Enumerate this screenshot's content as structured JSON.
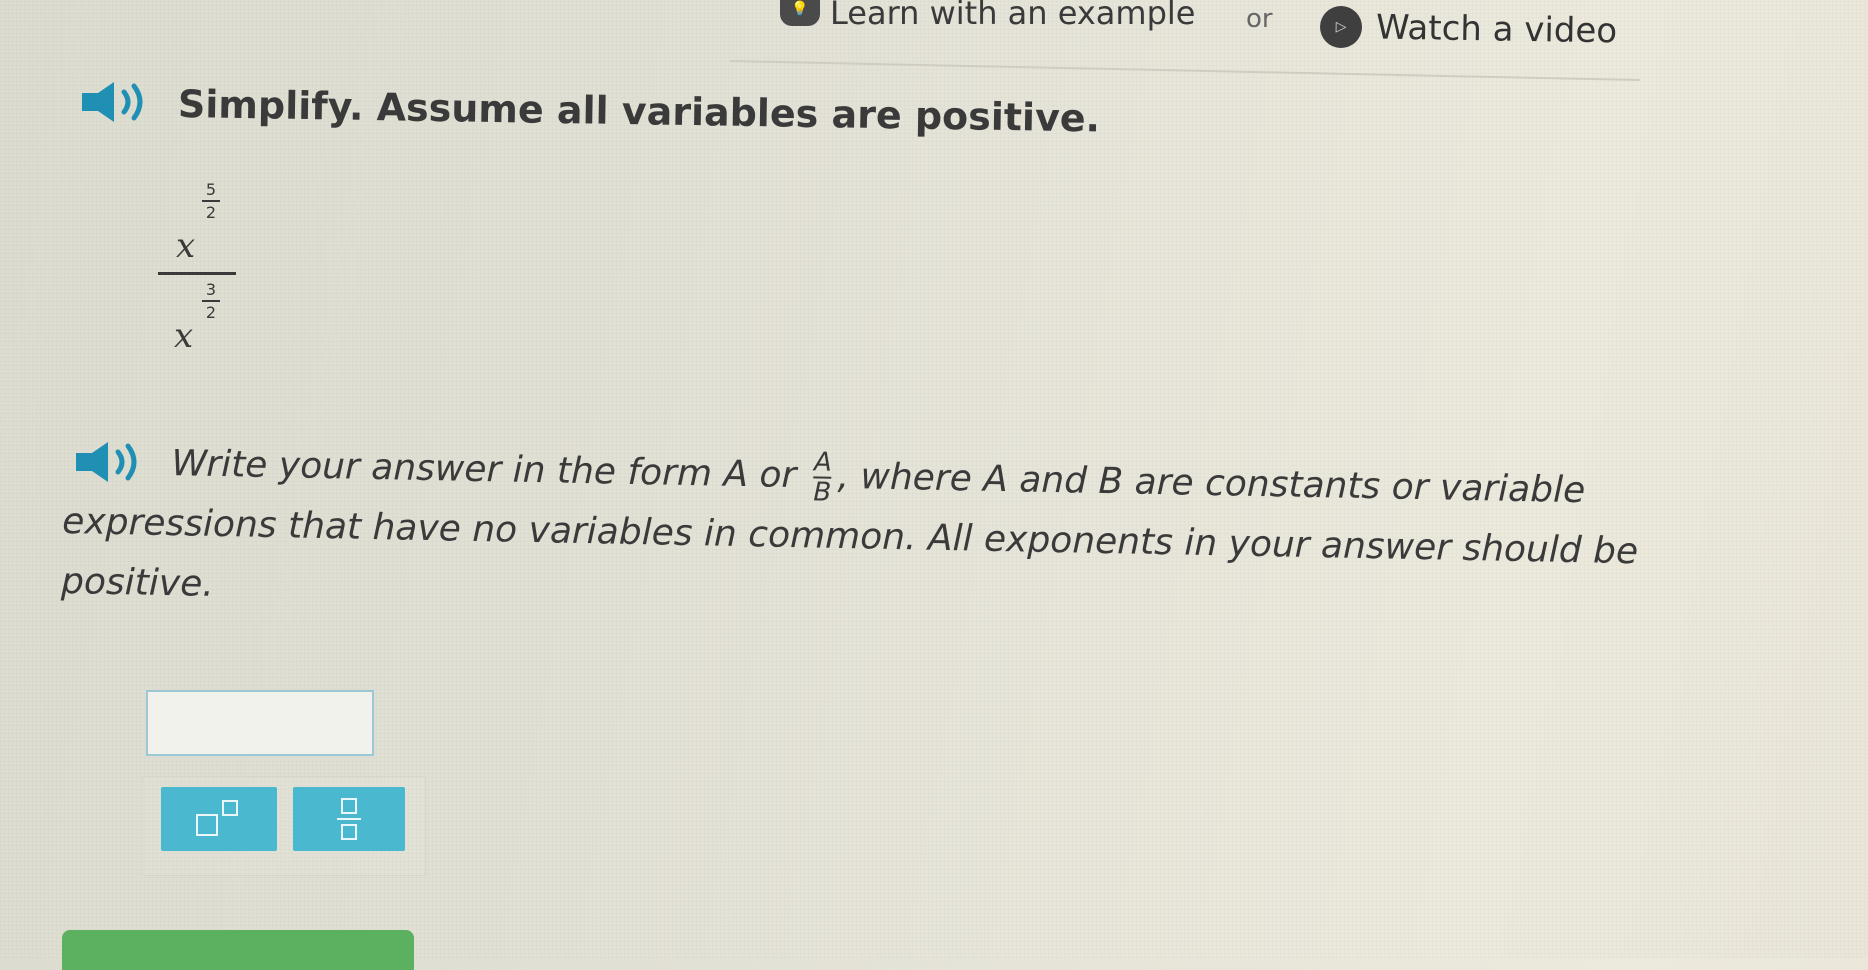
{
  "help": {
    "learn_label": "Learn with an example",
    "or_label": "or",
    "video_label": "Watch a video"
  },
  "question": {
    "prompt": "Simplify. Assume all variables are positive.",
    "expression": {
      "numerator_base": "x",
      "numerator_exp_num": "5",
      "numerator_exp_den": "2",
      "denominator_base": "x",
      "denominator_exp_num": "3",
      "denominator_exp_den": "2"
    },
    "instruction": {
      "part1": "Write your answer in the form A or ",
      "frac_num": "A",
      "frac_den": "B",
      "part2": ", where A and B are constants or variable",
      "line2": "expressions that have no variables in common. All exponents in your answer should be",
      "line3": "positive."
    }
  },
  "answer": {
    "value": ""
  },
  "tools": {
    "exponent_icon": "exponent-template-icon",
    "fraction_icon": "fraction-template-icon"
  },
  "colors": {
    "accent": "#4ab8ce",
    "check": "#5bb15f",
    "text": "#3a3a3a"
  }
}
